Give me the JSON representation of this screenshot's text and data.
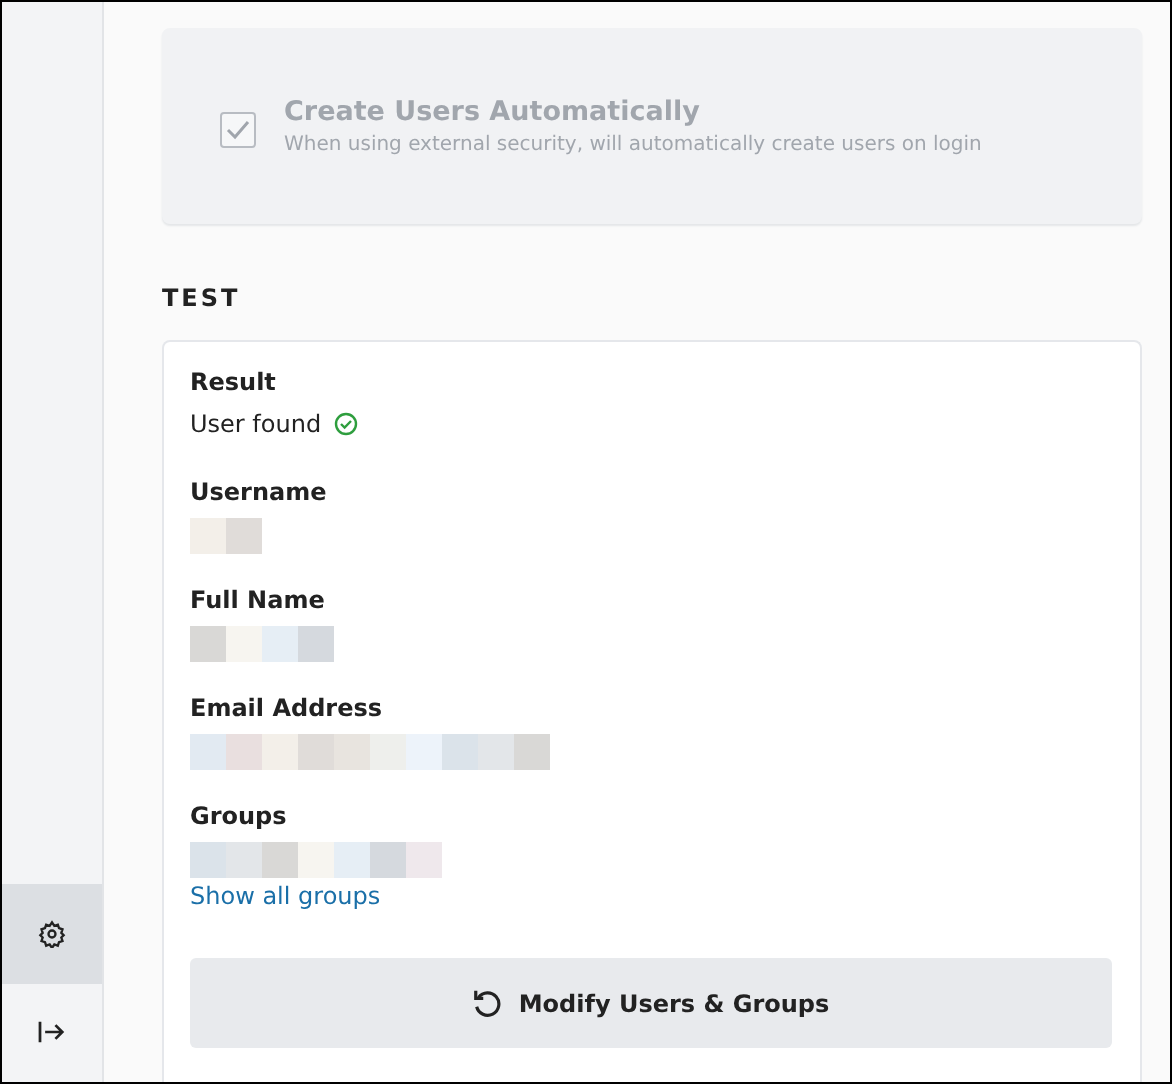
{
  "sidebar": {
    "items": [
      {
        "kind": "settings",
        "selected": true
      },
      {
        "kind": "logout",
        "selected": false
      }
    ]
  },
  "option": {
    "label": "Create Users Automatically",
    "description": "When using external security, will automatically create users on login",
    "checked": true,
    "disabled": true
  },
  "test": {
    "heading": "TEST",
    "result": {
      "label": "Result",
      "value": "User found",
      "success": true
    },
    "fields": [
      {
        "label": "Username"
      },
      {
        "label": "Full Name"
      },
      {
        "label": "Email Address"
      },
      {
        "label": "Groups"
      }
    ],
    "link": "Show all groups",
    "button": "Modify Users & Groups"
  }
}
